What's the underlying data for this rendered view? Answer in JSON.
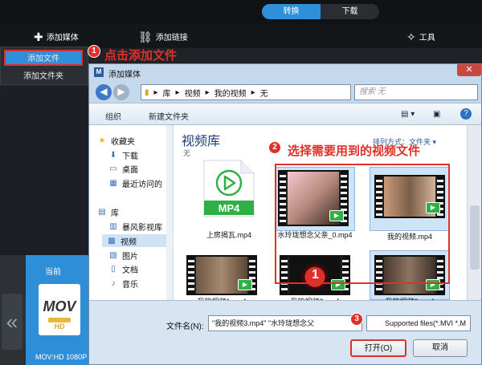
{
  "app": {
    "tabs": [
      {
        "label": "转换"
      },
      {
        "label": "下载"
      }
    ],
    "toolbar": {
      "add_media": "添加媒体",
      "add_link": "添加链接",
      "tools": "工具"
    },
    "dropdown": {
      "add_file": "添加文件",
      "add_folder": "添加文件夹"
    },
    "current_label": "当前",
    "current_file": {
      "icon_text": "MOV",
      "icon_sub": "HD",
      "name": "MOV:HD 1080P"
    }
  },
  "annotations": [
    {
      "num": "1",
      "text": "点击添加文件"
    },
    {
      "num": "2",
      "text": "选择需要用到的视频文件"
    },
    {
      "num": "3"
    }
  ],
  "dialog": {
    "title": "添加媒体",
    "close_glyph": "✕",
    "address": [
      "库",
      "视频",
      "我的视频",
      "无"
    ],
    "search_placeholder": "搜索 无",
    "commands": {
      "organize": "组织",
      "new_folder": "新建文件夹"
    },
    "nav": [
      {
        "icon": "star-icon",
        "label": "收藏夹"
      },
      {
        "icon": "download-icon",
        "label": "下载"
      },
      {
        "icon": "desktop-icon",
        "label": "桌面"
      },
      {
        "icon": "recent-icon",
        "label": "最近访问的"
      },
      {
        "icon": "library-icon",
        "label": "库"
      },
      {
        "icon": "library-folder-icon",
        "label": "暴风影视库"
      },
      {
        "icon": "video-icon",
        "label": "视频"
      },
      {
        "icon": "picture-icon",
        "label": "图片"
      },
      {
        "icon": "document-icon",
        "label": "文档"
      },
      {
        "icon": "music-icon",
        "label": "音乐"
      }
    ],
    "library_title": "视频库",
    "library_sub": "无",
    "arrange": "排列方式：文件夹 ▾",
    "files": [
      {
        "name": "上房揭瓦.mp4",
        "kind": "mp4-doc"
      },
      {
        "name": "水玲珑想念父亲_0.mp4",
        "selected": true
      },
      {
        "name": "我的视频.mp4",
        "selected": true
      },
      {
        "name": "我的视频1.mp4"
      },
      {
        "name": "我的视频2.mp4"
      },
      {
        "name": "我的视频3.mp4",
        "selected": true
      }
    ],
    "mp4_label": "MP4",
    "filename_label": "文件名(N):",
    "filename_value": "\"我的视频3.mp4\" \"水玲珑想念父",
    "filetype_value": "Supported files(*.MVI *.M",
    "open_label": "打开(O)",
    "cancel_label": "取消"
  },
  "colors": {
    "accent": "#2f8fd8",
    "annotation": "#e0302b",
    "badge": "#2fb046"
  }
}
